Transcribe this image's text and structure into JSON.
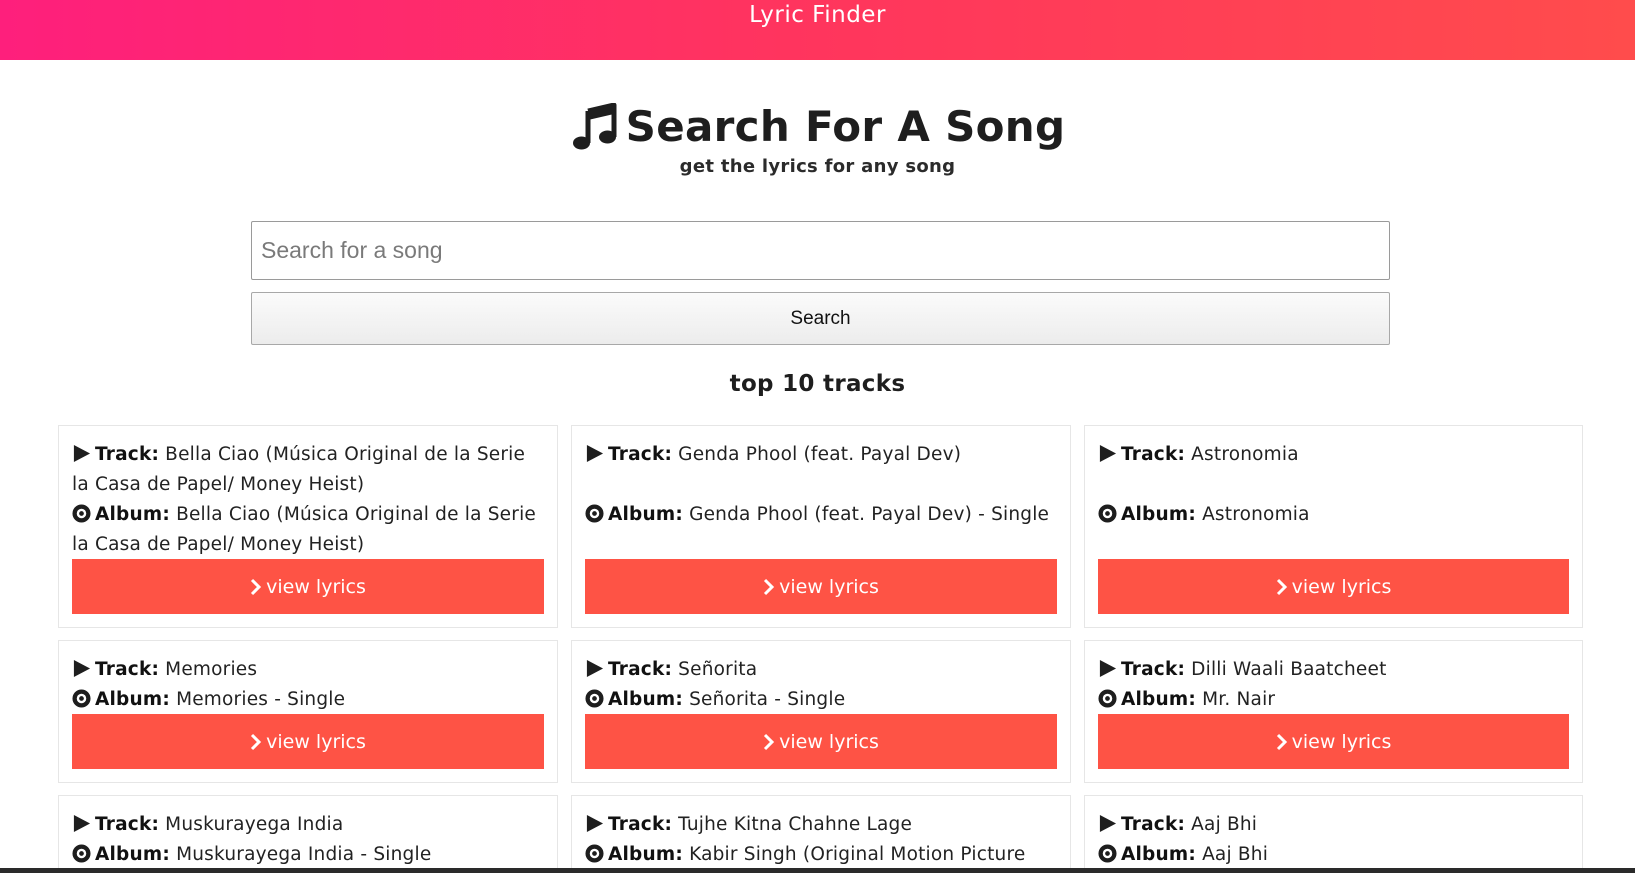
{
  "header": {
    "brand": "Lyric Finder"
  },
  "hero": {
    "icon": "music-note-icon",
    "title": "Search For A Song",
    "subtitle": "get the lyrics for any song"
  },
  "search": {
    "placeholder": "Search for a song",
    "value": "",
    "button_label": "Search"
  },
  "tracks_section": {
    "heading": "top 10 tracks",
    "track_label": "Track",
    "album_label": "Album",
    "button_label": "view lyrics",
    "cards": [
      {
        "track": "Bella Ciao (Música Original de la Serie la Casa de Papel/ Money Heist)",
        "album": "Bella Ciao (Música Original de la Serie la Casa de Papel/ Money Heist)"
      },
      {
        "track": "Genda Phool (feat. Payal Dev)",
        "album": "Genda Phool (feat. Payal Dev) - Single"
      },
      {
        "track": "Astronomia",
        "album": "Astronomia"
      },
      {
        "track": "Memories",
        "album": "Memories - Single"
      },
      {
        "track": "Señorita",
        "album": "Señorita - Single"
      },
      {
        "track": "Dilli Waali Baatcheet",
        "album": "Mr. Nair"
      },
      {
        "track": "Muskurayega India",
        "album": "Muskurayega India - Single"
      },
      {
        "track": "Tujhe Kitna Chahne Lage",
        "album": "Kabir Singh (Original Motion Picture"
      },
      {
        "track": "Aaj Bhi",
        "album": "Aaj Bhi"
      }
    ]
  },
  "colors": {
    "header_gradient_start": "#fe1f7c",
    "header_gradient_end": "#ff4c4c",
    "button_red": "#fe5345"
  }
}
